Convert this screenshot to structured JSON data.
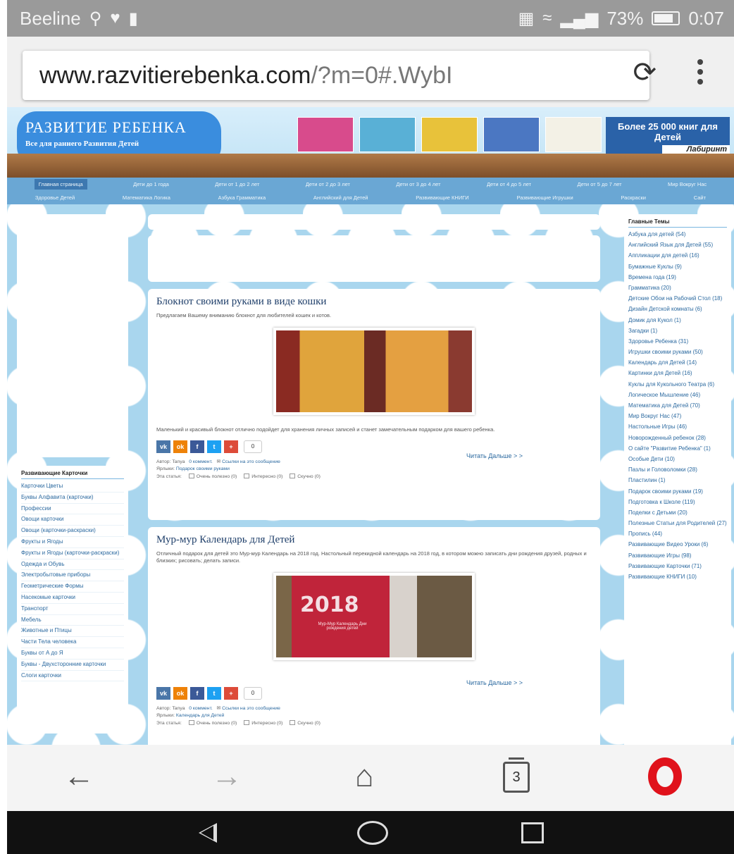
{
  "status_bar": {
    "carrier": "Beeline",
    "battery": "73%",
    "time": "0:07"
  },
  "address_bar": {
    "url_main": "www.razvitierebenka.com",
    "url_rest": "/?m=0#.WybI"
  },
  "site": {
    "logo_title": "РАЗВИТИЕ РЕБЕНКА",
    "logo_subtitle": "Все для раннего Развития Детей",
    "promo_text": "Более 25 000 книг для Детей",
    "promo_brand": "Лабиринт",
    "nav_row1": [
      "Главная страница",
      "Дети до 1 года",
      "Дети от 1 до 2 лет",
      "Дети от 2 до 3 лет",
      "Дети от 3 до 4 лет",
      "Дети от 4 до 5 лет",
      "Дети от 5 до 7 лет",
      "Мир Вокруг Нас"
    ],
    "nav_row2": [
      "Здоровье Детей",
      "Математика Логика",
      "Азбука Грамматика",
      "Английский для Детей",
      "Развивающие КНИГИ",
      "Развивающие Игрушки",
      "Раскраски",
      "Сайт"
    ]
  },
  "left_menu": {
    "title": "Развивающие Карточки",
    "items": [
      "Карточки Цветы",
      "Буквы Алфавита (карточки)",
      "Профессии",
      "Овощи карточки",
      "Овощи (карточки-раскраски)",
      "Фрукты и Ягоды",
      "Фрукты и Ягоды (карточки-раскраски)",
      "Одежда и Обувь",
      "Электробытовые приборы",
      "Геометрические Формы",
      "Насекомые карточки",
      "Транспорт",
      "Мебель",
      "Животные и Птицы",
      "Части Тела человека",
      "Буквы от А до Я",
      "Буквы - Двухсторонние карточки",
      "Слоги карточки"
    ]
  },
  "right_menu": {
    "title": "Главные Темы",
    "items": [
      "Азбука для детей (54)",
      "Английский Язык для Детей (55)",
      "Аппликации для детей (16)",
      "Бумажные Куклы (9)",
      "Времена года (19)",
      "Грамматика (20)",
      "Детские Обои на Рабочий Стол (18)",
      "Дизайн Детской комнаты (6)",
      "Домик для Кукол (1)",
      "Загадки (1)",
      "Здоровье Ребенка (31)",
      "Игрушки своими руками (50)",
      "Календарь для Детей (14)",
      "Картинки для Детей (16)",
      "Куклы для Кукольного Театра (6)",
      "Логическое Мышление (46)",
      "Математика для Детей (70)",
      "Мир Вокруг Нас (47)",
      "Настольные Игры (46)",
      "Новорожденный ребенок (28)",
      "О сайте \"Развитие Ребенка\" (1)",
      "Особые Дети (10)",
      "Пазлы и Головоломки (28)",
      "Пластилин (1)",
      "Подарок своими руками (19)",
      "Подготовка к Школе (119)",
      "Поделки с Детьми (20)",
      "Полезные Статьи для Родителей (27)",
      "Пропись (44)",
      "Развивающие Видео Уроки (6)",
      "Развивающие Игры (98)",
      "Развивающие Карточки (71)",
      "Развивающие КНИГИ (10)"
    ]
  },
  "posts": [
    {
      "title": "Блокнот своими руками в виде кошки",
      "intro": "Предлагаем Вашему вниманию блокнот для любителей кошек и котов.",
      "body": "Маленький и красивый блокнот отлично подойдет для хранения личных записей и станет замечательным подарком для вашего ребенка.",
      "read_more": "Читать Дальше > >",
      "share_count": "0",
      "author": "Автор: Tanya",
      "comments": "0 коммент.",
      "backlinks": "Ссылки на это сообщение",
      "labels_prefix": "Ярлыки:",
      "labels": "Подарок своими руками",
      "rating_prefix": "Эта статья:",
      "ratings": [
        "Очень полезно (0)",
        "Интересно (0)",
        "Скучно (0)"
      ]
    },
    {
      "title": "Мур-мур Календарь для Детей",
      "intro": "Отличный подарок для детей это Мур-мур Календарь на 2018 год. Настольный перекидной календарь на 2018 год, в котором можно записать дни рождения друзей, родных и близких; рисовать; делать записи.",
      "photo_year": "2018",
      "photo_caption": "Мур-Мур Календарь Дни рождения детей",
      "read_more": "Читать Дальше > >",
      "share_count": "0",
      "author": "Автор: Tanya",
      "comments": "0 коммент.",
      "backlinks": "Ссылки на это сообщение",
      "labels_prefix": "Ярлыки:",
      "labels": "Календарь для Детей",
      "rating_prefix": "Эта статья:",
      "ratings": [
        "Очень полезно (0)",
        "Интересно (0)",
        "Скучно (0)"
      ]
    }
  ],
  "browser_bar": {
    "tab_count": "3"
  },
  "icons": {
    "back": "arrow-left-icon",
    "forward": "arrow-right-icon",
    "home": "home-icon",
    "tabs": "tabs-icon",
    "opera": "opera-icon"
  },
  "colors": {
    "opera_red": "#e0121b",
    "link_blue": "#2c6aa0",
    "sky": "#a9d6ee"
  }
}
